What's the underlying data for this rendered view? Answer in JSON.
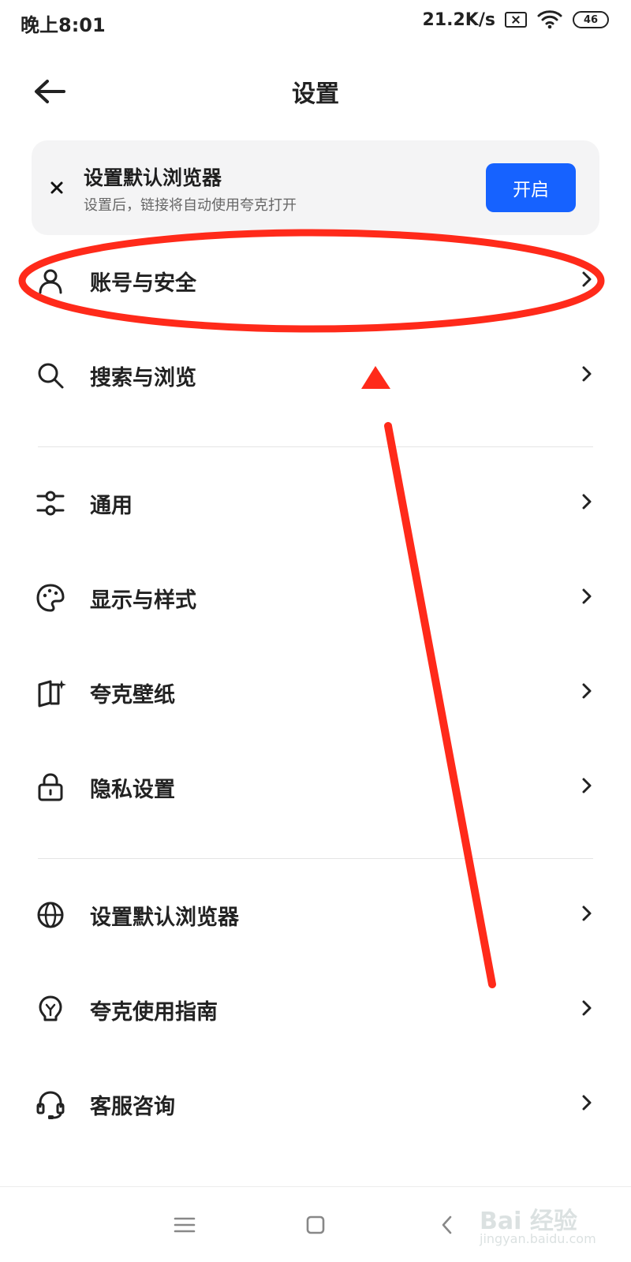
{
  "status_bar": {
    "time": "晚上8:01",
    "network_speed": "21.2K/s",
    "sim_icon": "sim-card-off-icon",
    "wifi_icon": "wifi-icon",
    "battery": "46"
  },
  "header": {
    "title": "设置",
    "back_icon": "back-arrow-icon"
  },
  "banner": {
    "title": "设置默认浏览器",
    "subtitle": "设置后，链接将自动使用夸克打开",
    "button_label": "开启",
    "close_icon": "close-icon",
    "accent": "#1662ff"
  },
  "menu_items": [
    {
      "label": "账号与安全",
      "icon": "user-icon"
    },
    {
      "label": "搜索与浏览",
      "icon": "search-icon"
    },
    {
      "label": "通用",
      "icon": "sliders-icon"
    },
    {
      "label": "显示与样式",
      "icon": "palette-icon"
    },
    {
      "label": "夸克壁纸",
      "icon": "wallpaper-icon"
    },
    {
      "label": "隐私设置",
      "icon": "lock-icon"
    },
    {
      "label": "设置默认浏览器",
      "icon": "globe-icon"
    },
    {
      "label": "夸克使用指南",
      "icon": "lightbulb-icon"
    },
    {
      "label": "客服咨询",
      "icon": "headset-icon"
    }
  ],
  "bottom_nav": {
    "menu_icon": "menu-icon",
    "home_icon": "home-icon",
    "back_icon": "back-chevron-icon"
  },
  "watermark": {
    "main": "Bai 经验",
    "sub": "jingyan.baidu.com"
  },
  "annotation": {
    "color": "#ff2a1a"
  }
}
